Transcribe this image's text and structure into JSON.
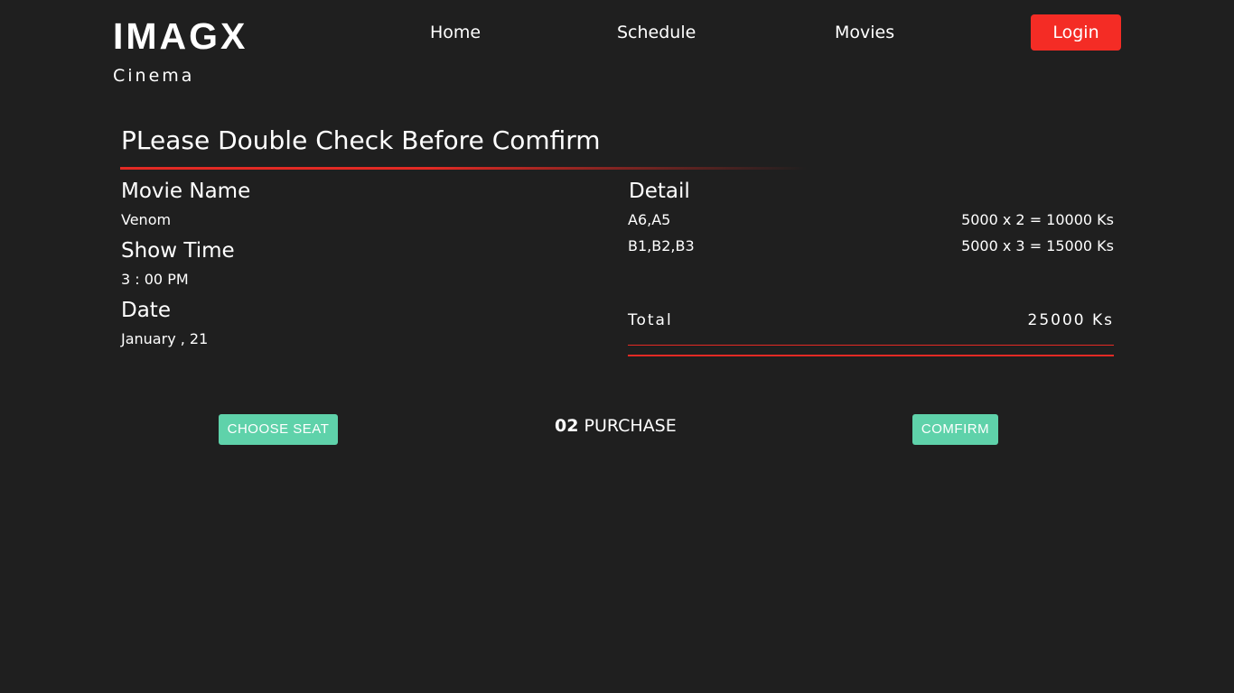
{
  "brand": {
    "title": "IMAGX",
    "subtitle": "Cinema"
  },
  "nav": {
    "home": "Home",
    "schedule": "Schedule",
    "movies": "Movies",
    "login": "Login"
  },
  "confirmation": {
    "heading": "PLease Double Check Before Comfirm",
    "movie_label": "Movie Name",
    "movie_value": "Venom",
    "showtime_label": "Show Time",
    "showtime_value": "3 : 00 PM",
    "date_label": "Date",
    "date_value": "January , 21",
    "detail_label": "Detail",
    "details": [
      {
        "seats": "A6,A5",
        "calc": "5000 x 2 = 10000 Ks"
      },
      {
        "seats": "B1,B2,B3",
        "calc": "5000 x 3 = 15000 Ks"
      }
    ],
    "total_label": "Total",
    "total_value": "25000 Ks"
  },
  "steps": {
    "back_label": "CHOOSE SEAT",
    "current_number": "02",
    "current_label": "PURCHASE",
    "next_label": "COMFIRM"
  },
  "colors": {
    "background": "#1f1f1f",
    "accent_red": "#f42c25",
    "button_green": "#5fd2aa"
  }
}
